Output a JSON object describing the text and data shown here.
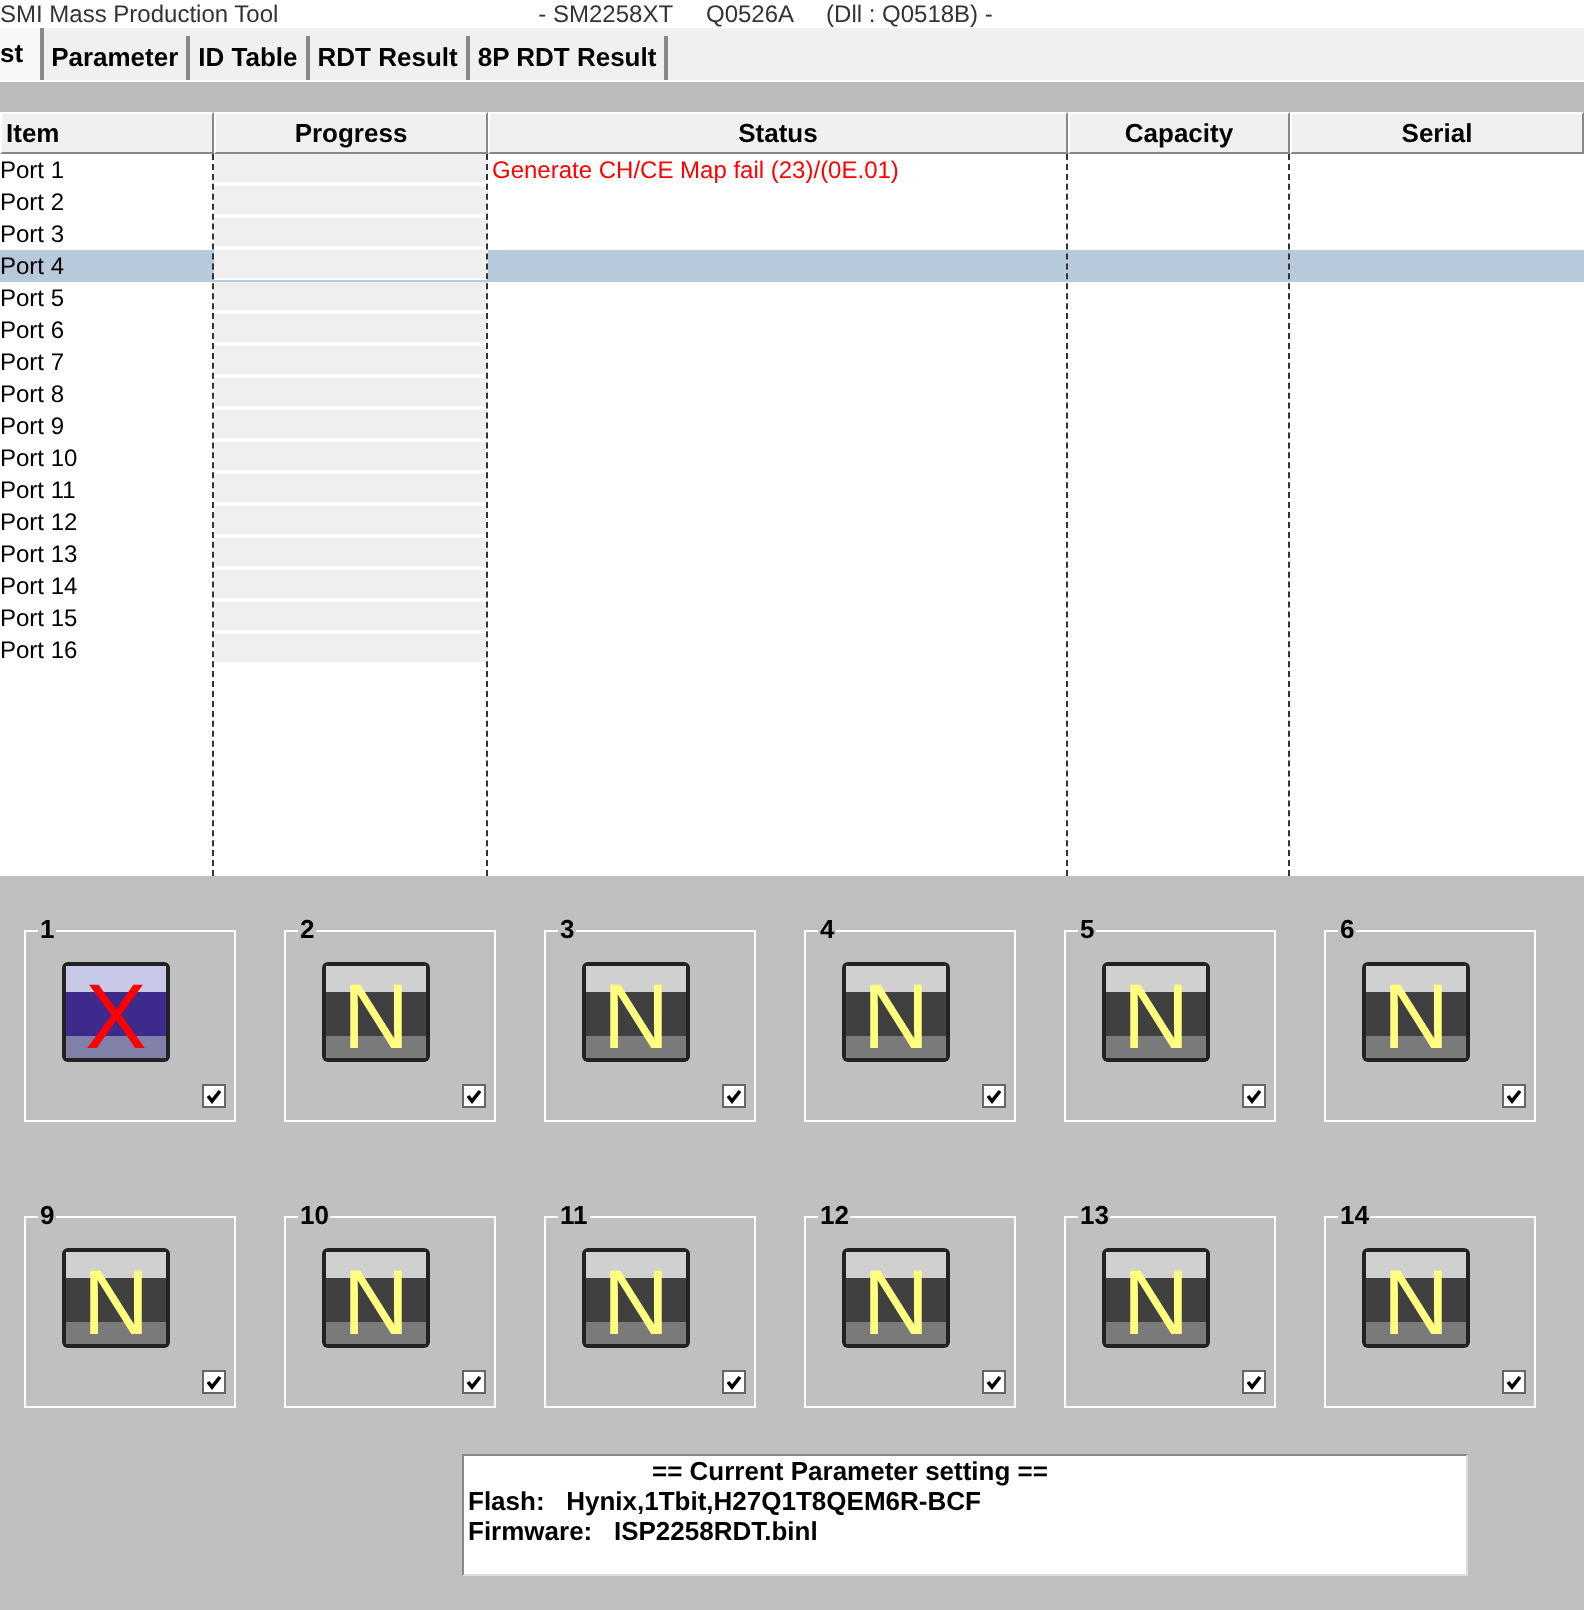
{
  "window": {
    "title": "SMI Mass Production Tool",
    "version": "- SM2258XT     Q0526A     (Dll : Q0518B) -"
  },
  "tabs": [
    {
      "label": "st",
      "selected": true
    },
    {
      "label": "Parameter",
      "selected": false
    },
    {
      "label": "ID Table",
      "selected": false
    },
    {
      "label": "RDT Result",
      "selected": false
    },
    {
      "label": "8P RDT Result",
      "selected": false
    }
  ],
  "table": {
    "columns": [
      "Item",
      "Progress",
      "Status",
      "Capacity",
      "Serial"
    ],
    "rows": [
      {
        "item": "Port 1",
        "status": "Generate CH/CE Map fail (23)/(0E.01)",
        "selected": false
      },
      {
        "item": "Port 2",
        "selected": false
      },
      {
        "item": "Port 3",
        "selected": false
      },
      {
        "item": "Port 4",
        "selected": true
      },
      {
        "item": "Port 5",
        "selected": false
      },
      {
        "item": "Port 6",
        "selected": false
      },
      {
        "item": "Port 7",
        "selected": false
      },
      {
        "item": "Port 8",
        "selected": false
      },
      {
        "item": "Port 9",
        "selected": false
      },
      {
        "item": "Port 10",
        "selected": false
      },
      {
        "item": "Port 11",
        "selected": false
      },
      {
        "item": "Port 12",
        "selected": false
      },
      {
        "item": "Port 13",
        "selected": false
      },
      {
        "item": "Port 14",
        "selected": false
      },
      {
        "item": "Port 15",
        "selected": false
      },
      {
        "item": "Port 16",
        "selected": false
      }
    ]
  },
  "ports": [
    {
      "number": "1",
      "kind": "fail",
      "mark": "X",
      "checked": true
    },
    {
      "number": "2",
      "kind": "ready",
      "mark": "N",
      "checked": true
    },
    {
      "number": "3",
      "kind": "ready",
      "mark": "N",
      "checked": true
    },
    {
      "number": "4",
      "kind": "ready",
      "mark": "N",
      "checked": true
    },
    {
      "number": "5",
      "kind": "ready",
      "mark": "N",
      "checked": true
    },
    {
      "number": "6",
      "kind": "ready",
      "mark": "N",
      "checked": true
    },
    {
      "number": "9",
      "kind": "ready",
      "mark": "N",
      "checked": true
    },
    {
      "number": "10",
      "kind": "ready",
      "mark": "N",
      "checked": true
    },
    {
      "number": "11",
      "kind": "ready",
      "mark": "N",
      "checked": true
    },
    {
      "number": "12",
      "kind": "ready",
      "mark": "N",
      "checked": true
    },
    {
      "number": "13",
      "kind": "ready",
      "mark": "N",
      "checked": true
    },
    {
      "number": "14",
      "kind": "ready",
      "mark": "N",
      "checked": true
    }
  ],
  "parameter_setting": {
    "heading": "== Current Parameter setting ==",
    "lines": [
      "Flash:   Hynix,1Tbit,H27Q1T8QEM6R-BCF",
      "Firmware:   ISP2258RDT.binl"
    ]
  }
}
